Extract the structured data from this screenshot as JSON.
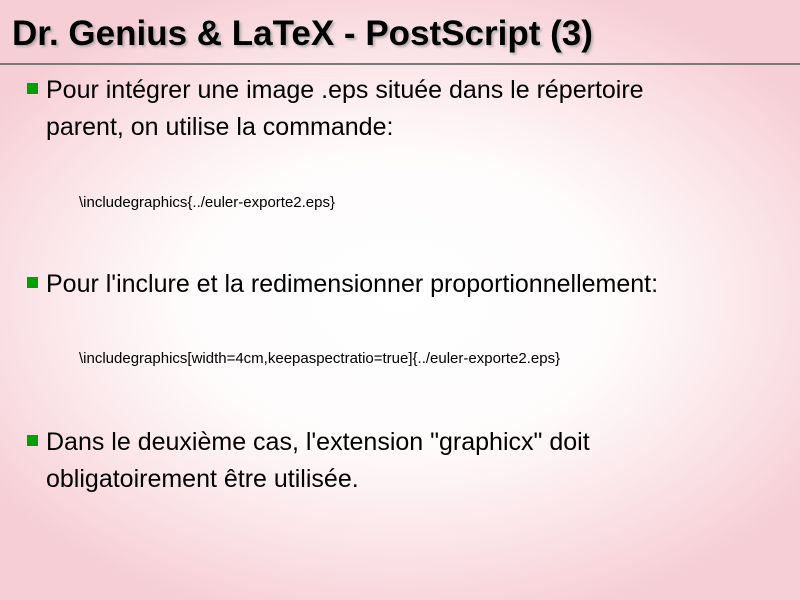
{
  "slide": {
    "title": "Dr. Genius & LaTeX - PostScript (3)",
    "items": [
      {
        "bullet_line1": "Pour intégrer une image .eps située dans le répertoire",
        "bullet_line2": "parent, on utilise la commande:",
        "code": "\\includegraphics{../euler-exporte2.eps}"
      },
      {
        "bullet_line1": "Pour l'inclure et la redimensionner proportionnellement:",
        "code": "\\includegraphics[width=4cm,keepaspectratio=true]{../euler-exporte2.eps}"
      },
      {
        "bullet_line1": "Dans le deuxième cas, l'extension \"graphicx\" doit",
        "bullet_line2": "obligatoirement être utilisée."
      }
    ]
  },
  "colors": {
    "bullet": "#00a000",
    "background_edge": "#f6cfd6",
    "title_rule": "#7a7a7a"
  }
}
